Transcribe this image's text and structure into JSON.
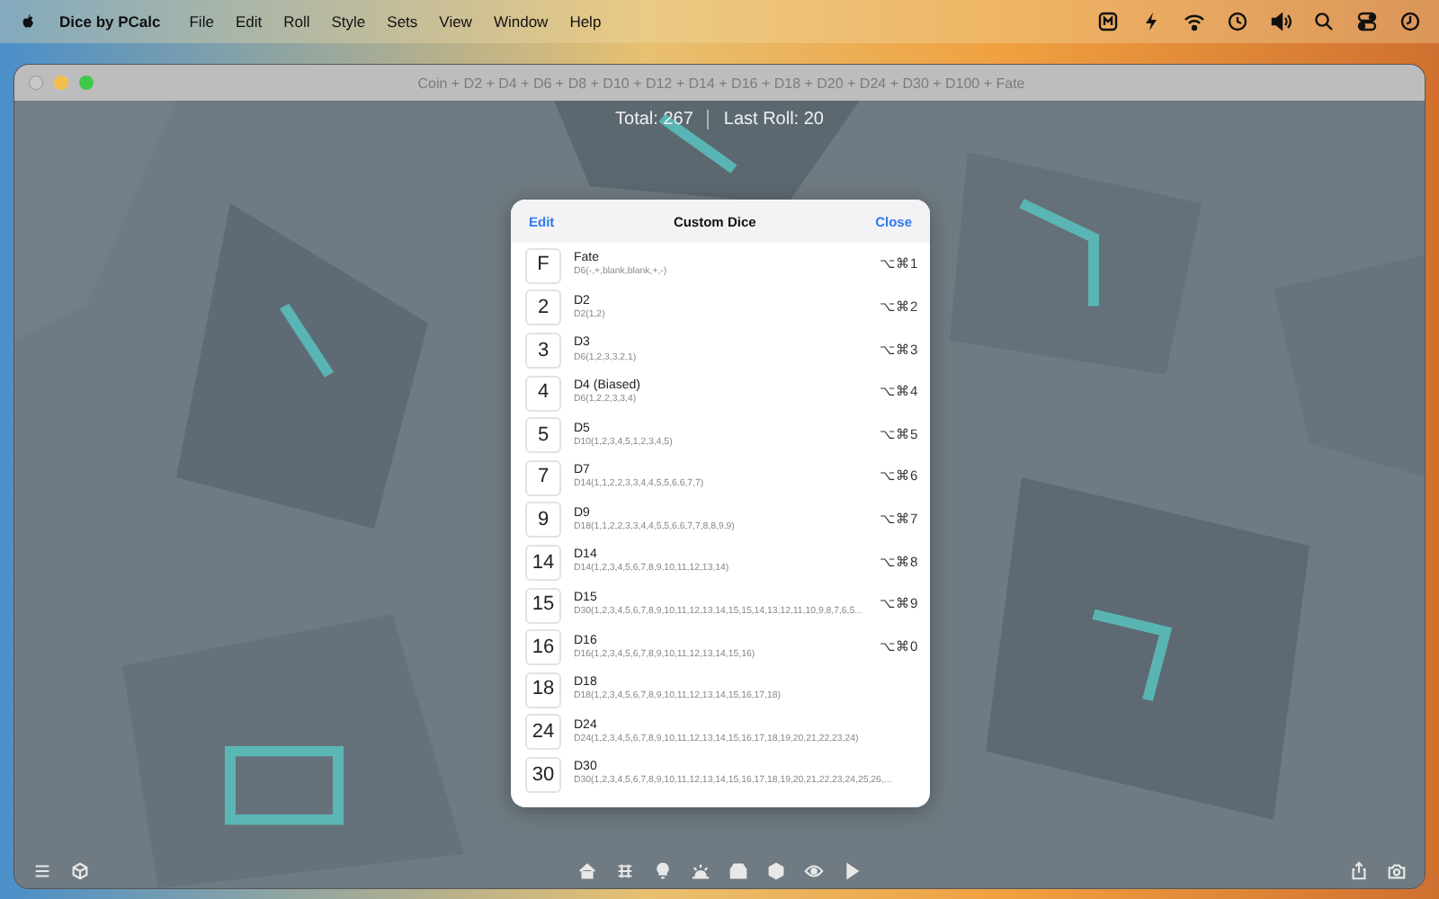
{
  "menu_bar": {
    "app_name": "Dice by PCalc",
    "menus": [
      "File",
      "Edit",
      "Roll",
      "Style",
      "Sets",
      "View",
      "Window",
      "Help"
    ]
  },
  "window": {
    "title": "Coin + D2 + D4 + D6 + D8 + D10 + D12 + D14 + D16 + D18 + D20 + D24 + D30 + D100 + Fate",
    "total": "Total: 267",
    "last_roll": "Last Roll: 20"
  },
  "dialog": {
    "edit": "Edit",
    "title": "Custom Dice",
    "close": "Close",
    "dice": [
      {
        "face": "F",
        "name": "Fate",
        "definition": "D6(-,+,blank,blank,+,-)",
        "shortcut": "⌥⌘1"
      },
      {
        "face": "2",
        "name": "D2",
        "definition": "D2(1,2)",
        "shortcut": "⌥⌘2"
      },
      {
        "face": "3",
        "name": "D3",
        "definition": "D6(1,2,3,3,2,1)",
        "shortcut": "⌥⌘3"
      },
      {
        "face": "4",
        "name": "D4 (Biased)",
        "definition": "D6(1,2,2,3,3,4)",
        "shortcut": "⌥⌘4"
      },
      {
        "face": "5",
        "name": "D5",
        "definition": "D10(1,2,3,4,5,1,2,3,4,5)",
        "shortcut": "⌥⌘5"
      },
      {
        "face": "7",
        "name": "D7",
        "definition": "D14(1,1,2,2,3,3,4,4,5,5,6,6,7,7)",
        "shortcut": "⌥⌘6"
      },
      {
        "face": "9",
        "name": "D9",
        "definition": "D18(1,1,2,2,3,3,4,4,5,5,6,6,7,7,8,8,9,9)",
        "shortcut": "⌥⌘7"
      },
      {
        "face": "14",
        "name": "D14",
        "definition": "D14(1,2,3,4,5,6,7,8,9,10,11,12,13,14)",
        "shortcut": "⌥⌘8"
      },
      {
        "face": "15",
        "name": "D15",
        "definition": "D30(1,2,3,4,5,6,7,8,9,10,11,12,13,14,15,15,14,13,12,11,10,9,8,7,6,5...",
        "shortcut": "⌥⌘9"
      },
      {
        "face": "16",
        "name": "D16",
        "definition": "D16(1,2,3,4,5,6,7,8,9,10,11,12,13,14,15,16)",
        "shortcut": "⌥⌘0"
      },
      {
        "face": "18",
        "name": "D18",
        "definition": "D18(1,2,3,4,5,6,7,8,9,10,11,12,13,14,15,16,17,18)"
      },
      {
        "face": "24",
        "name": "D24",
        "definition": "D24(1,2,3,4,5,6,7,8,9,10,11,12,13,14,15,16,17,18,19,20,21,22,23,24)"
      },
      {
        "face": "30",
        "name": "D30",
        "definition": "D30(1,2,3,4,5,6,7,8,9,10,11,12,13,14,15,16,17,18,19,20,21,22,23,24,25,26,..."
      }
    ]
  }
}
